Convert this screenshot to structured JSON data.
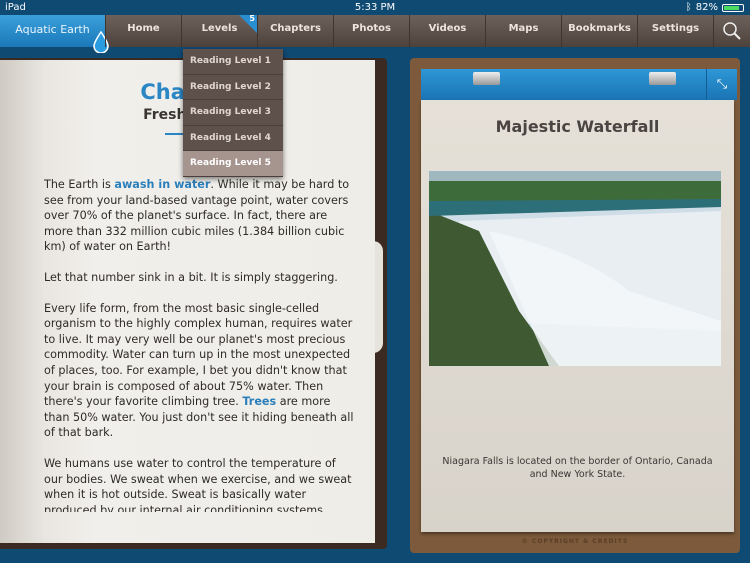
{
  "status": {
    "device": "iPad",
    "time": "5:33 PM",
    "battery": "82%"
  },
  "nav": {
    "brand": "Aquatic Earth",
    "items": [
      "Home",
      "Levels",
      "Chapters",
      "Photos",
      "Videos",
      "Maps",
      "Bookmarks",
      "Settings"
    ],
    "levels_badge": "5"
  },
  "levels_menu": {
    "items": [
      "Reading Level 1",
      "Reading Level 2",
      "Reading Level 3",
      "Reading Level 4",
      "Reading Level 5"
    ],
    "selected": "Reading Level 5"
  },
  "chapter": {
    "title": "Chapter",
    "subtitle": "Freshwater",
    "p1": [
      "The Earth is ",
      "awash in water",
      ". While it may be hard to see from your land-based vantage point, water covers over 70% of the planet's surface. In fact, there are more than 332 million cubic miles (1.384 billion cubic km) of water on Earth!"
    ],
    "p2": "Let that number sink in a bit. It is simply staggering.",
    "p3": [
      "Every life form, from the most basic single-celled organism to the highly complex human, requires water to live. It may very well be our planet's most precious commodity. Water can turn up in the most unexpected of places, too. For example, I bet you didn't know that your brain is composed of about 75% water. Then there's your favorite climbing tree. ",
      "Trees",
      " are more than 50% water. You just don't see it hiding beneath all of that bark."
    ],
    "p4": "We humans use water to control the temperature of our bodies. We sweat when we exercise, and we sweat when it is hot outside. Sweat is basically water produced by our internal air conditioning systems, cooling us down when exertion or external temperature threatens to overheat our organs."
  },
  "panel": {
    "title": "Majestic Waterfall",
    "caption": "Niagara Falls is located on the border of Ontario, Canada and New York State.",
    "copyright": "© COPYRIGHT & CREDITS"
  }
}
